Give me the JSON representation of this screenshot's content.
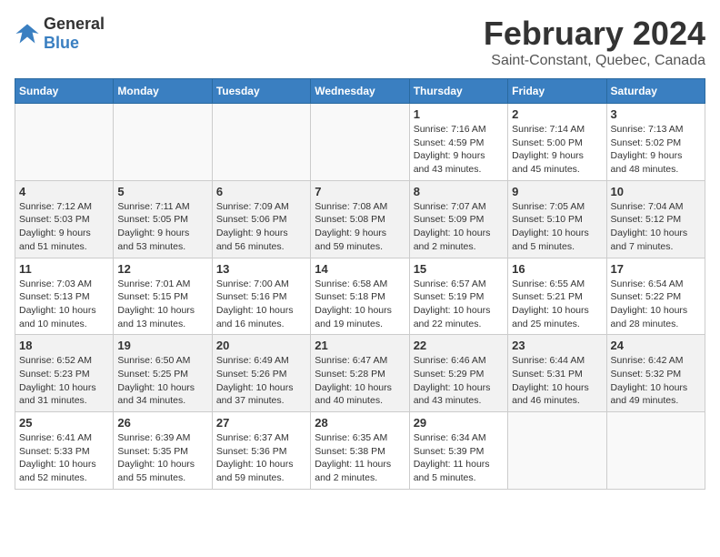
{
  "header": {
    "logo_general": "General",
    "logo_blue": "Blue",
    "month": "February 2024",
    "location": "Saint-Constant, Quebec, Canada"
  },
  "weekdays": [
    "Sunday",
    "Monday",
    "Tuesday",
    "Wednesday",
    "Thursday",
    "Friday",
    "Saturday"
  ],
  "weeks": [
    [
      {
        "day": "",
        "info": ""
      },
      {
        "day": "",
        "info": ""
      },
      {
        "day": "",
        "info": ""
      },
      {
        "day": "",
        "info": ""
      },
      {
        "day": "1",
        "info": "Sunrise: 7:16 AM\nSunset: 4:59 PM\nDaylight: 9 hours\nand 43 minutes."
      },
      {
        "day": "2",
        "info": "Sunrise: 7:14 AM\nSunset: 5:00 PM\nDaylight: 9 hours\nand 45 minutes."
      },
      {
        "day": "3",
        "info": "Sunrise: 7:13 AM\nSunset: 5:02 PM\nDaylight: 9 hours\nand 48 minutes."
      }
    ],
    [
      {
        "day": "4",
        "info": "Sunrise: 7:12 AM\nSunset: 5:03 PM\nDaylight: 9 hours\nand 51 minutes."
      },
      {
        "day": "5",
        "info": "Sunrise: 7:11 AM\nSunset: 5:05 PM\nDaylight: 9 hours\nand 53 minutes."
      },
      {
        "day": "6",
        "info": "Sunrise: 7:09 AM\nSunset: 5:06 PM\nDaylight: 9 hours\nand 56 minutes."
      },
      {
        "day": "7",
        "info": "Sunrise: 7:08 AM\nSunset: 5:08 PM\nDaylight: 9 hours\nand 59 minutes."
      },
      {
        "day": "8",
        "info": "Sunrise: 7:07 AM\nSunset: 5:09 PM\nDaylight: 10 hours\nand 2 minutes."
      },
      {
        "day": "9",
        "info": "Sunrise: 7:05 AM\nSunset: 5:10 PM\nDaylight: 10 hours\nand 5 minutes."
      },
      {
        "day": "10",
        "info": "Sunrise: 7:04 AM\nSunset: 5:12 PM\nDaylight: 10 hours\nand 7 minutes."
      }
    ],
    [
      {
        "day": "11",
        "info": "Sunrise: 7:03 AM\nSunset: 5:13 PM\nDaylight: 10 hours\nand 10 minutes."
      },
      {
        "day": "12",
        "info": "Sunrise: 7:01 AM\nSunset: 5:15 PM\nDaylight: 10 hours\nand 13 minutes."
      },
      {
        "day": "13",
        "info": "Sunrise: 7:00 AM\nSunset: 5:16 PM\nDaylight: 10 hours\nand 16 minutes."
      },
      {
        "day": "14",
        "info": "Sunrise: 6:58 AM\nSunset: 5:18 PM\nDaylight: 10 hours\nand 19 minutes."
      },
      {
        "day": "15",
        "info": "Sunrise: 6:57 AM\nSunset: 5:19 PM\nDaylight: 10 hours\nand 22 minutes."
      },
      {
        "day": "16",
        "info": "Sunrise: 6:55 AM\nSunset: 5:21 PM\nDaylight: 10 hours\nand 25 minutes."
      },
      {
        "day": "17",
        "info": "Sunrise: 6:54 AM\nSunset: 5:22 PM\nDaylight: 10 hours\nand 28 minutes."
      }
    ],
    [
      {
        "day": "18",
        "info": "Sunrise: 6:52 AM\nSunset: 5:23 PM\nDaylight: 10 hours\nand 31 minutes."
      },
      {
        "day": "19",
        "info": "Sunrise: 6:50 AM\nSunset: 5:25 PM\nDaylight: 10 hours\nand 34 minutes."
      },
      {
        "day": "20",
        "info": "Sunrise: 6:49 AM\nSunset: 5:26 PM\nDaylight: 10 hours\nand 37 minutes."
      },
      {
        "day": "21",
        "info": "Sunrise: 6:47 AM\nSunset: 5:28 PM\nDaylight: 10 hours\nand 40 minutes."
      },
      {
        "day": "22",
        "info": "Sunrise: 6:46 AM\nSunset: 5:29 PM\nDaylight: 10 hours\nand 43 minutes."
      },
      {
        "day": "23",
        "info": "Sunrise: 6:44 AM\nSunset: 5:31 PM\nDaylight: 10 hours\nand 46 minutes."
      },
      {
        "day": "24",
        "info": "Sunrise: 6:42 AM\nSunset: 5:32 PM\nDaylight: 10 hours\nand 49 minutes."
      }
    ],
    [
      {
        "day": "25",
        "info": "Sunrise: 6:41 AM\nSunset: 5:33 PM\nDaylight: 10 hours\nand 52 minutes."
      },
      {
        "day": "26",
        "info": "Sunrise: 6:39 AM\nSunset: 5:35 PM\nDaylight: 10 hours\nand 55 minutes."
      },
      {
        "day": "27",
        "info": "Sunrise: 6:37 AM\nSunset: 5:36 PM\nDaylight: 10 hours\nand 59 minutes."
      },
      {
        "day": "28",
        "info": "Sunrise: 6:35 AM\nSunset: 5:38 PM\nDaylight: 11 hours\nand 2 minutes."
      },
      {
        "day": "29",
        "info": "Sunrise: 6:34 AM\nSunset: 5:39 PM\nDaylight: 11 hours\nand 5 minutes."
      },
      {
        "day": "",
        "info": ""
      },
      {
        "day": "",
        "info": ""
      }
    ]
  ]
}
